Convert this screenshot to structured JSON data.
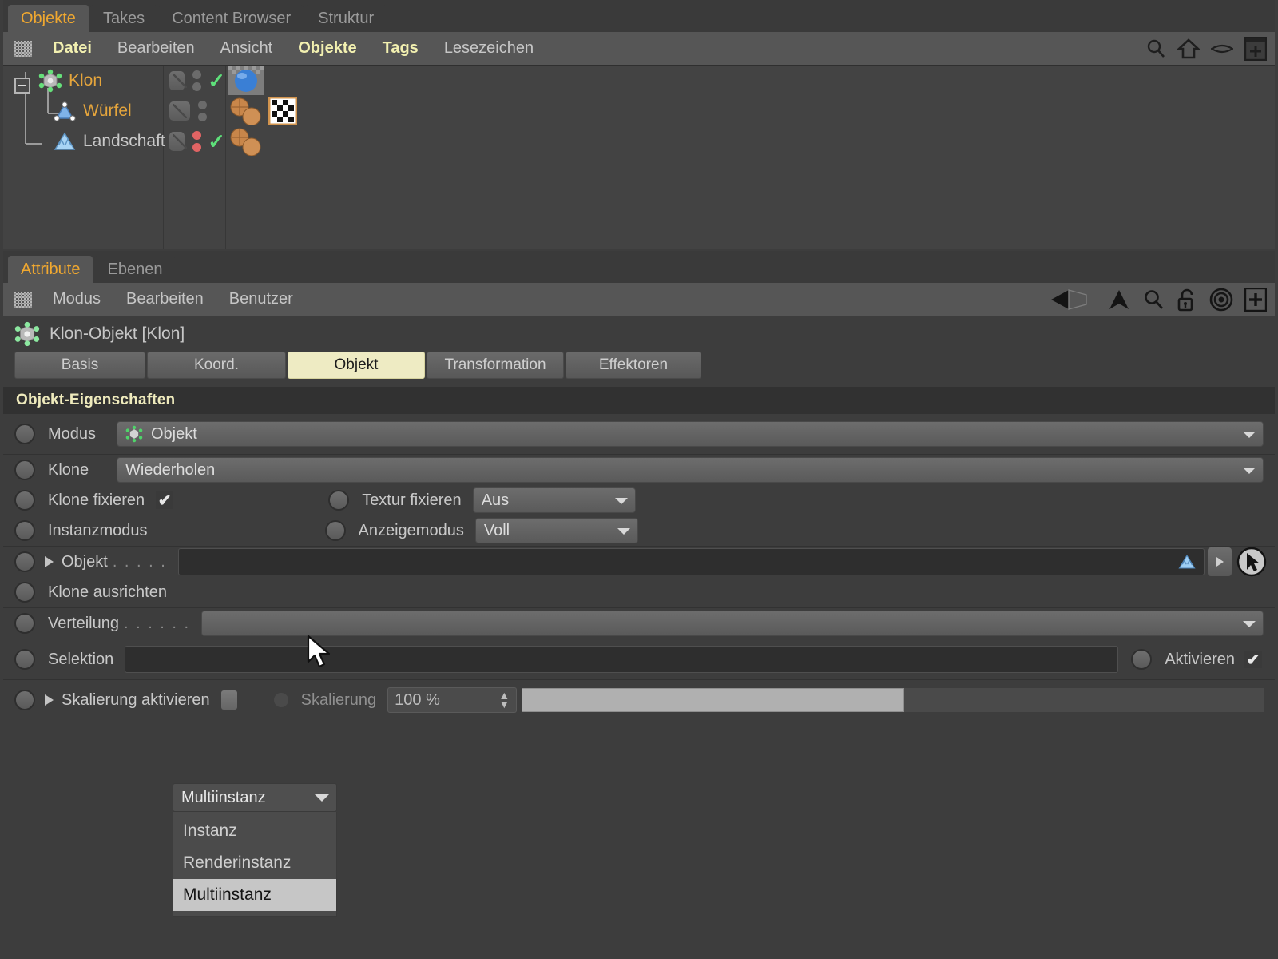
{
  "object_manager": {
    "tabs": [
      {
        "label": "Objekte",
        "active": true
      },
      {
        "label": "Takes",
        "active": false
      },
      {
        "label": "Content Browser",
        "active": false
      },
      {
        "label": "Struktur",
        "active": false
      }
    ],
    "menu": [
      {
        "label": "Datei",
        "highlight": true
      },
      {
        "label": "Bearbeiten",
        "highlight": false
      },
      {
        "label": "Ansicht",
        "highlight": false
      },
      {
        "label": "Objekte",
        "highlight": true
      },
      {
        "label": "Tags",
        "highlight": true
      },
      {
        "label": "Lesezeichen",
        "highlight": false
      }
    ],
    "toolbar_icons": [
      "search-icon",
      "home-icon",
      "eye-icon",
      "add-icon"
    ],
    "tree": [
      {
        "name": "Klon",
        "name_color": "#e5a53c",
        "icon": "cloner-icon",
        "depth": 0,
        "expanded": true,
        "dots": [
          "gray",
          "gray"
        ],
        "check": true,
        "tags": [
          "sphere-material-tag"
        ]
      },
      {
        "name": "Würfel",
        "name_color": "#e5a53c",
        "icon": "polygon-object-icon",
        "depth": 1,
        "expanded": false,
        "dots": [
          "gray",
          "gray"
        ],
        "check": false,
        "tags": [
          "material-tag",
          "uvw-tag"
        ]
      },
      {
        "name": "Landschaft",
        "name_color": "#c9c9c9",
        "icon": "landscape-icon",
        "depth": 1,
        "expanded": false,
        "dots": [
          "red",
          "red"
        ],
        "check": true,
        "tags": [
          "material-tag"
        ]
      }
    ]
  },
  "attribute_manager": {
    "tabs": [
      {
        "label": "Attribute",
        "active": true
      },
      {
        "label": "Ebenen",
        "active": false
      }
    ],
    "menu": [
      {
        "label": "Modus"
      },
      {
        "label": "Bearbeiten"
      },
      {
        "label": "Benutzer"
      }
    ],
    "toolbar_icons": [
      "back-arrow-icon",
      "forward-arrow-icon",
      "up-arrow-icon",
      "search-icon",
      "unlock-icon",
      "target-icon",
      "add-icon"
    ],
    "object_title": "Klon-Objekt [Klon]",
    "object_icon": "cloner-icon",
    "subtabs": [
      {
        "label": "Basis",
        "active": false
      },
      {
        "label": "Koord.",
        "active": false
      },
      {
        "label": "Objekt",
        "active": true
      },
      {
        "label": "Transformation",
        "active": false
      },
      {
        "label": "Effektoren",
        "active": false
      }
    ],
    "section_title": "Objekt-Eigenschaften",
    "fields": {
      "modus_label": "Modus",
      "modus_value": "Objekt",
      "klone_label": "Klone",
      "klone_value": "Wiederholen",
      "klone_fixieren_label": "Klone fixieren",
      "klone_fixieren_checked": true,
      "textur_fixieren_label": "Textur fixieren",
      "textur_fixieren_value": "Aus",
      "instanzmodus_label": "Instanzmodus",
      "instanzmodus_value": "Multiinstanz",
      "anzeigemodus_label": "Anzeigemodus",
      "anzeigemodus_value": "Voll",
      "objekt_label": "Objekt",
      "objekt_dots": ". . . . .",
      "objekt_value": "",
      "objekt_icon": "landscape-icon",
      "klone_ausrichten_label": "Klone ausrichten",
      "verteilung_label": "Verteilung",
      "verteilung_dots": ". . . . . .",
      "selektion_label": "Selektion",
      "selektion_value": "",
      "aktivieren_label": "Aktivieren",
      "aktivieren_checked": true,
      "skalierung_aktivieren_label": "Skalierung aktivieren",
      "skalierung_aktivieren_checked": false,
      "skalierung_label": "Skalierung",
      "skalierung_value": "100 %"
    },
    "open_dropdown": {
      "button_value": "Multiinstanz",
      "items": [
        {
          "label": "Instanz",
          "selected": false
        },
        {
          "label": "Renderinstanz",
          "selected": false
        },
        {
          "label": "Multiinstanz",
          "selected": true
        }
      ]
    }
  },
  "colors": {
    "accent_orange": "#f0a830",
    "accent_cream": "#eeebc3",
    "panel_bg": "#3d3d3d",
    "tree_bg": "#434343",
    "menu_bg": "#565656",
    "check_green": "#5ee07a",
    "dot_red": "#e06464"
  }
}
